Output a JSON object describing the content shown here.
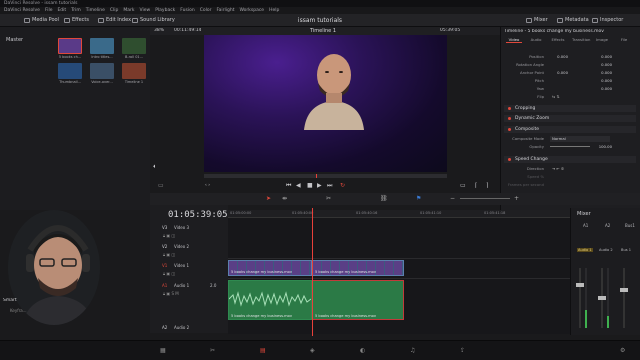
{
  "window": {
    "title": "DaVinci Resolve - issam tutorials",
    "menu": [
      "DaVinci Resolve",
      "File",
      "Edit",
      "Trim",
      "Timeline",
      "Clip",
      "Mark",
      "View",
      "Playback",
      "Fusion",
      "Color",
      "Fairlight",
      "Workspace",
      "Help"
    ]
  },
  "toolbar": {
    "media_pool": "Media Pool",
    "effects": "Effects",
    "edit_index": "Edit Index",
    "sound_library": "Sound Library",
    "project_title": "issam tutorials",
    "mixer": "Mixer",
    "metadata": "Metadata",
    "inspector": "Inspector"
  },
  "media_pool": {
    "folder": "Master",
    "clips": [
      {
        "label": "5 books ch...",
        "color": "#5a3a88"
      },
      {
        "label": "Intro titles...",
        "color": "#3a6a8a"
      },
      {
        "label": "B-roll 01...",
        "color": "#2f4e2f"
      },
      {
        "label": "Thumbnail...",
        "color": "#264a78"
      },
      {
        "label": "Voice-over...",
        "color": "#3a4f66"
      },
      {
        "label": "Timeline 1",
        "color": "#7a3a2a"
      }
    ]
  },
  "viewer": {
    "zoom": "38%",
    "timecode_left": "00:11:49:14",
    "timeline_name": "Timeline 1",
    "timecode_right": "05:39:05"
  },
  "inspector": {
    "title": "Timeline - 5 books change my business.mov",
    "tabs": [
      "Video",
      "Audio",
      "Effects",
      "Transition",
      "Image",
      "File"
    ],
    "transform_rows": [
      {
        "label": "Position",
        "x": "0.000",
        "y": "0.000"
      },
      {
        "label": "Rotation Angle",
        "x": "0.000",
        "y": ""
      },
      {
        "label": "Anchor Point",
        "x": "0.000",
        "y": "0.000"
      },
      {
        "label": "Pitch",
        "x": "0.000",
        "y": ""
      },
      {
        "label": "Yaw",
        "x": "0.000",
        "y": ""
      },
      {
        "label": "Flip",
        "x": "",
        "y": ""
      }
    ],
    "sections": [
      "Cropping",
      "Dynamic Zoom",
      "Composite",
      "Speed Change"
    ],
    "composite_mode_label": "Composite Mode",
    "composite_mode_value": "Normal",
    "opacity_label": "Opacity",
    "opacity_value": "100.00",
    "direction_label": "Direction",
    "speed_label": "Speed %",
    "frames_label": "Frames per second"
  },
  "timeline": {
    "timecode": "01:05:39:05",
    "ruler_ticks": [
      "01:05:00:00",
      "01:05:40:00",
      "01:05:40:16",
      "01:05:41:10",
      "01:05:41:18"
    ],
    "tracks": [
      {
        "tag": "V3",
        "name": "Video 3"
      },
      {
        "tag": "V2",
        "name": "Video 2"
      },
      {
        "tag": "V1",
        "name": "Video 1"
      },
      {
        "tag": "A1",
        "name": "Audio 1",
        "level": "2.0"
      },
      {
        "tag": "A2",
        "name": "Audio 2"
      }
    ],
    "clip_name": "5 books change my business.mov"
  },
  "mixer": {
    "title": "Mixer",
    "channels": [
      "A1",
      "A2",
      "Bus1"
    ],
    "channel_labels": [
      "Audio 1",
      "Audio 2",
      "Bus 1"
    ]
  },
  "webcam": {
    "label_left": "Smart",
    "label_left2": "Keyfra..."
  },
  "colors": {
    "accent_red": "#e0483b",
    "clip_blue": "#3c5a7f",
    "clip_green": "#2b7a46"
  }
}
